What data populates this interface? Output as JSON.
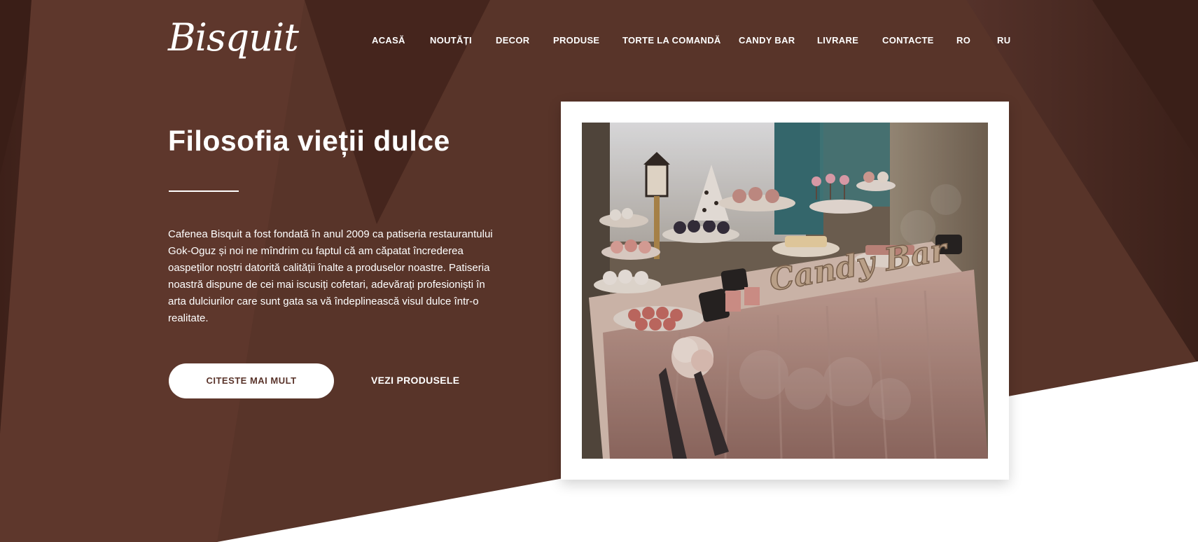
{
  "brand": {
    "logo_text": "Bisquit"
  },
  "nav": {
    "items": [
      {
        "label": "ACASĂ"
      },
      {
        "label": "NOUTĂȚI"
      },
      {
        "label": "DECOR"
      },
      {
        "label": "PRODUSE"
      },
      {
        "label": "TORTE LA COMANDĂ"
      },
      {
        "label": "CANDY BAR"
      },
      {
        "label": "LIVRARE"
      },
      {
        "label": "CONTACTE"
      },
      {
        "label": "RO"
      },
      {
        "label": "RU"
      }
    ]
  },
  "hero": {
    "title": "Filosofia vieții dulce",
    "description": "Cafenea Bisquit a fost fondată în anul 2009 ca patiseria restaurantului Gok-Oguz și noi ne mîndrim cu faptul că am căpatat încrederea oaspeților noștri datorită calității înalte a produselor noastre. Patiseria noastră dispune de cei mai iscusiți cofetari, adevărați profesioniști în arta dulciurilor care sunt gata sa vă îndeplinească visul dulce într-o realitate.",
    "primary_button": "CITESTE MAI MULT",
    "secondary_link": "VEZI PRODUSELE",
    "photo_sign_text": "Candy Bar"
  },
  "colors": {
    "brand_brown": "#5a342b",
    "dark_brown": "#4a2a22",
    "white": "#ffffff"
  }
}
